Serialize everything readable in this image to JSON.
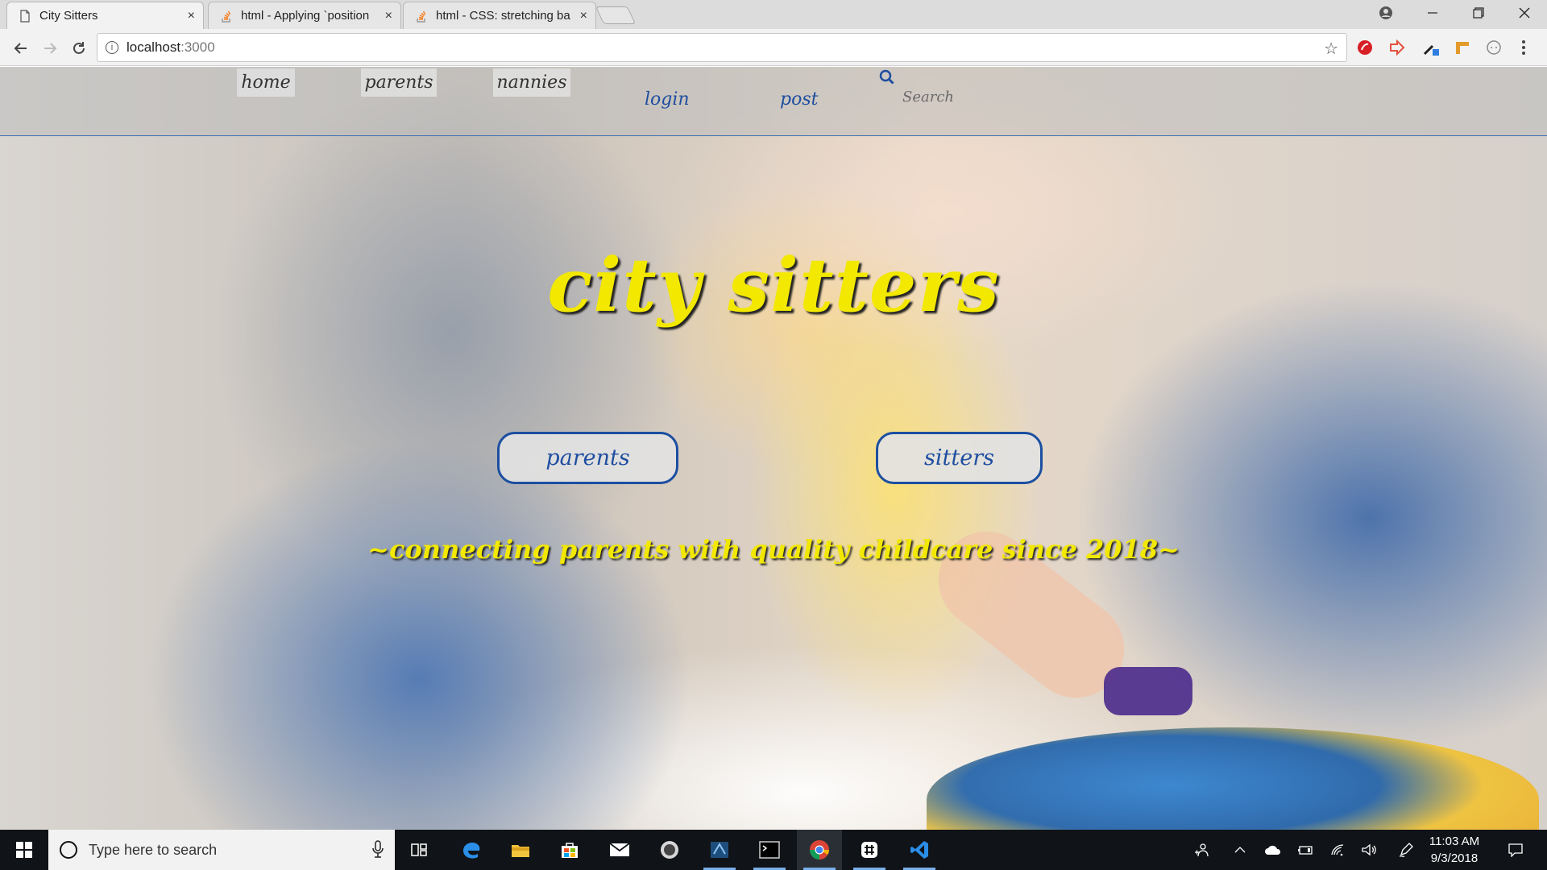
{
  "browser": {
    "tabs": [
      {
        "title": "City Sitters",
        "active": true
      },
      {
        "title": "html - Applying `position",
        "active": false
      },
      {
        "title": "html - CSS: stretching ba",
        "active": false
      }
    ],
    "close_glyph": "×",
    "url_host": "localhost",
    "url_port": ":3000"
  },
  "site": {
    "nav_tabs": [
      "home",
      "parents",
      "nannies"
    ],
    "nav_links": [
      "login",
      "post"
    ],
    "search_placeholder": "Search",
    "title": "city sitters",
    "cta_parents": "parents",
    "cta_sitters": "sitters",
    "tagline": "~connecting parents with quality childcare since 2018~"
  },
  "taskbar": {
    "search_placeholder": "Type here to search",
    "time": "11:03 AM",
    "date": "9/3/2018"
  },
  "colors": {
    "accent_yellow": "#f2e800",
    "link_blue": "#1f4ea0",
    "taskbar": "#101317"
  }
}
